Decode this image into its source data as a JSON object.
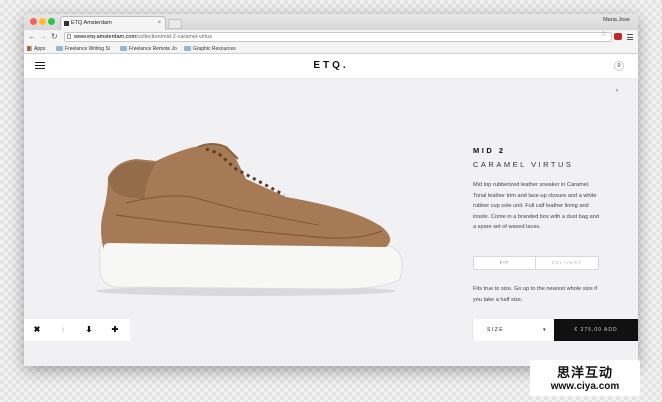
{
  "browser": {
    "tab_title": "ETQ Amsterdam",
    "tab_close": "×",
    "user_name": "Maria Jose",
    "url_host": "www.etq-amsterdam.com",
    "url_path": "/collection/mid-2-caramel-virtus",
    "back_glyph": "←",
    "forward_glyph": "→",
    "reload_glyph": "↻",
    "star_glyph": "☆",
    "bookmarks": [
      "Apps",
      "Freelance Writing Si",
      "Freelance Remote Jo",
      "Graphic Resources"
    ],
    "traffic_colors": [
      "#ff5f57",
      "#febc2e",
      "#28c840"
    ]
  },
  "site": {
    "logo": "ETQ.",
    "cart_count": "0",
    "back_arrow": "‹"
  },
  "product": {
    "title": "MID 2",
    "subtitle": "CARAMEL VIRTUS",
    "description": "Mid top rubberized leather sneaker in Caramel. Tonal leather trim and lace-up closure and a white rubber cup sole unit. Full calf leather lining and insole. Come in a branded box with a dust bag and a spare set of waxed laces.",
    "tabs": [
      "FIT",
      "DELIVERY"
    ],
    "fit_text": "Fits true to size. Go up to the nearest whole size if you take a half size.",
    "size_label": "SIZE",
    "size_caret": "▾",
    "price_label": "€ 275,00 ADD",
    "shoe_colors": {
      "upper": "#a57a55",
      "upper_dark": "#8a6342",
      "sole": "#f7f7f5"
    }
  },
  "toolbar_icons": [
    {
      "name": "close-icon",
      "glyph": "✖"
    },
    {
      "name": "info-icon",
      "glyph": "i"
    },
    {
      "name": "download-icon",
      "glyph": "⬇"
    },
    {
      "name": "plus-icon",
      "glyph": "✚"
    }
  ],
  "watermark": {
    "line1": "思洋互动",
    "line2": "www.ciya.com"
  }
}
